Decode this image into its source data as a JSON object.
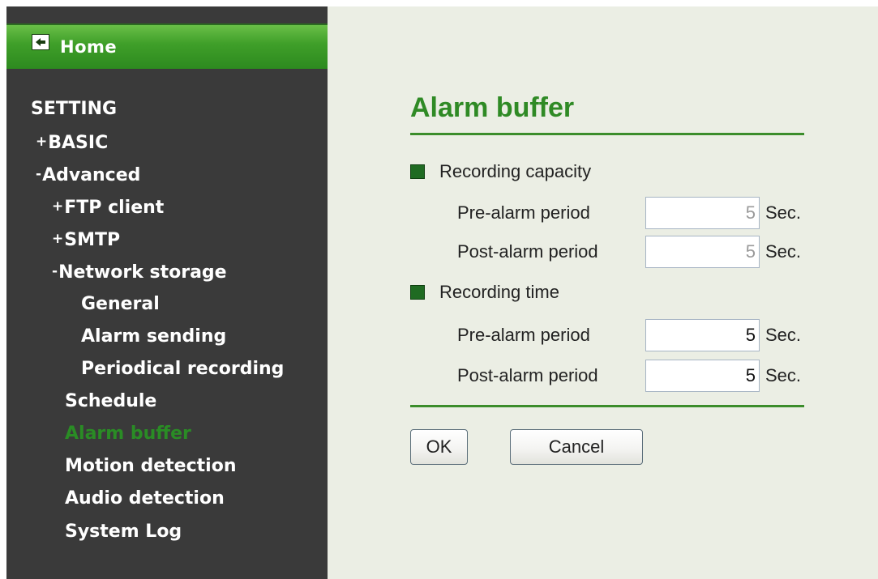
{
  "sidebar": {
    "home_label": "Home",
    "section_title": "SETTING",
    "items": [
      {
        "label": "BASIC",
        "sign": "+"
      },
      {
        "label": "Advanced",
        "sign": "-"
      },
      {
        "label": "FTP client",
        "sign": "+"
      },
      {
        "label": "SMTP",
        "sign": "+"
      },
      {
        "label": "Network storage",
        "sign": "-"
      },
      {
        "label": "General"
      },
      {
        "label": "Alarm sending"
      },
      {
        "label": "Periodical recording"
      },
      {
        "label": "Schedule"
      },
      {
        "label": "Alarm buffer",
        "active": true
      },
      {
        "label": "Motion detection"
      },
      {
        "label": "Audio detection"
      },
      {
        "label": "System Log"
      }
    ],
    "active_color": "#2a8c25"
  },
  "main": {
    "title": "Alarm buffer",
    "groups": [
      {
        "label": "Recording capacity",
        "fields": [
          {
            "label": "Pre-alarm period",
            "value": "5",
            "unit": "Sec.",
            "disabled": true
          },
          {
            "label": "Post-alarm period",
            "value": "5",
            "unit": "Sec.",
            "disabled": true
          }
        ]
      },
      {
        "label": "Recording time",
        "fields": [
          {
            "label": "Pre-alarm period",
            "value": "5",
            "unit": "Sec.",
            "disabled": false
          },
          {
            "label": "Post-alarm period",
            "value": "5",
            "unit": "Sec.",
            "disabled": false
          }
        ]
      }
    ],
    "buttons": {
      "ok_label": "OK",
      "cancel_label": "Cancel"
    }
  },
  "colors": {
    "sidebar_bg": "#3a3a3a",
    "main_bg": "#ebeee4",
    "accent_green": "#2f8a25",
    "bullet_green": "#1f6b22"
  },
  "icons": {
    "home": "back-arrow-icon",
    "bullet": "square-bullet-icon"
  }
}
